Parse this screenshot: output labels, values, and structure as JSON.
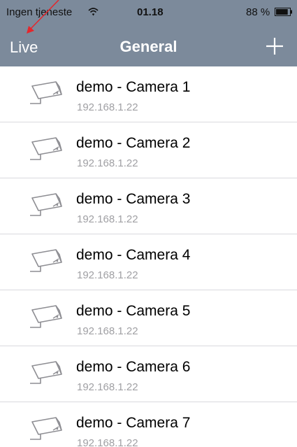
{
  "status_bar": {
    "carrier": "Ingen tjeneste",
    "time": "01.18",
    "battery_percent": "88 %",
    "battery_level": 0.88
  },
  "nav": {
    "left_label": "Live",
    "title": "General",
    "add_icon": "plus-icon"
  },
  "colors": {
    "nav_background": "#7c8a9b",
    "annotation_arrow": "#e5262b",
    "separator": "#d9d9de",
    "subtitle": "#a0a0a4"
  },
  "cameras": [
    {
      "name": "demo - Camera 1",
      "address": "192.168.1.22"
    },
    {
      "name": "demo - Camera 2",
      "address": "192.168.1.22"
    },
    {
      "name": "demo - Camera 3",
      "address": "192.168.1.22"
    },
    {
      "name": "demo - Camera 4",
      "address": "192.168.1.22"
    },
    {
      "name": "demo - Camera 5",
      "address": "192.168.1.22"
    },
    {
      "name": "demo - Camera 6",
      "address": "192.168.1.22"
    },
    {
      "name": "demo - Camera 7",
      "address": "192.168.1.22"
    }
  ]
}
